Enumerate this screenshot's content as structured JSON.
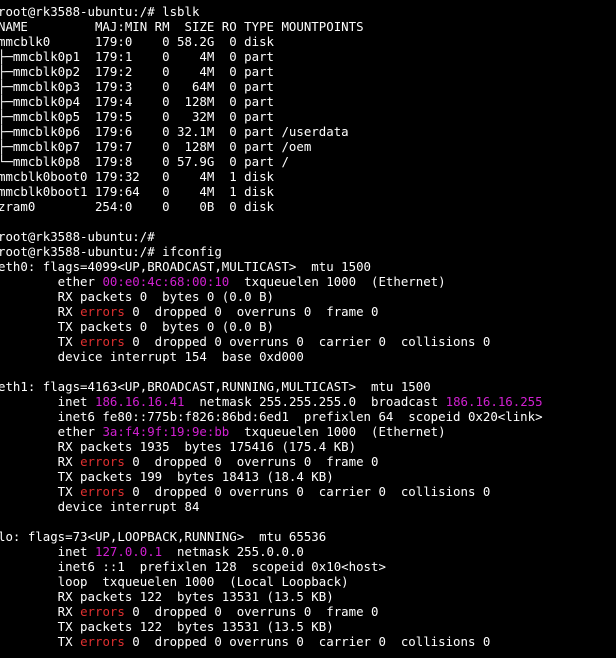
{
  "terminal": {
    "title": "",
    "colors": {
      "background": "#000000",
      "foreground": "#ffffff",
      "highlight": "#d020d0",
      "error": "#e03030"
    },
    "lines": [
      [
        {
          "t": "root@rk3588-ubuntu:/# lsblk"
        }
      ],
      [
        {
          "t": "NAME         MAJ:MIN RM  SIZE RO TYPE MOUNTPOINTS"
        }
      ],
      [
        {
          "t": "mmcblk0      179:0    0 58.2G  0 disk"
        }
      ],
      [
        {
          "t": "├─mmcblk0p1  179:1    0    4M  0 part"
        }
      ],
      [
        {
          "t": "├─mmcblk0p2  179:2    0    4M  0 part"
        }
      ],
      [
        {
          "t": "├─mmcblk0p3  179:3    0   64M  0 part"
        }
      ],
      [
        {
          "t": "├─mmcblk0p4  179:4    0  128M  0 part"
        }
      ],
      [
        {
          "t": "├─mmcblk0p5  179:5    0   32M  0 part"
        }
      ],
      [
        {
          "t": "├─mmcblk0p6  179:6    0 32.1M  0 part /userdata"
        }
      ],
      [
        {
          "t": "├─mmcblk0p7  179:7    0  128M  0 part /oem"
        }
      ],
      [
        {
          "t": "└─mmcblk0p8  179:8    0 57.9G  0 part /"
        }
      ],
      [
        {
          "t": "mmcblk0boot0 179:32   0    4M  1 disk"
        }
      ],
      [
        {
          "t": "mmcblk0boot1 179:64   0    4M  1 disk"
        }
      ],
      [
        {
          "t": "zram0        254:0    0    0B  0 disk"
        }
      ],
      [
        {
          "t": ""
        }
      ],
      [
        {
          "t": "root@rk3588-ubuntu:/#"
        }
      ],
      [
        {
          "t": "root@rk3588-ubuntu:/# ifconfig"
        }
      ],
      [
        {
          "t": "eth0: flags=4099<UP,BROADCAST,MULTICAST>  mtu 1500"
        }
      ],
      [
        {
          "t": "        ether "
        },
        {
          "t": "00:e0:4c:68:00:10",
          "c": "hl"
        },
        {
          "t": "  txqueuelen 1000  (Ethernet)"
        }
      ],
      [
        {
          "t": "        RX packets 0  bytes 0 (0.0 B)"
        }
      ],
      [
        {
          "t": "        RX "
        },
        {
          "t": "errors",
          "c": "err"
        },
        {
          "t": " 0  dropped 0  overruns 0  frame 0"
        }
      ],
      [
        {
          "t": "        TX packets 0  bytes 0 (0.0 B)"
        }
      ],
      [
        {
          "t": "        TX "
        },
        {
          "t": "errors",
          "c": "err"
        },
        {
          "t": " 0  dropped 0 overruns 0  carrier 0  collisions 0"
        }
      ],
      [
        {
          "t": "        device interrupt 154  base 0xd000"
        }
      ],
      [
        {
          "t": ""
        }
      ],
      [
        {
          "t": "eth1: flags=4163<UP,BROADCAST,RUNNING,MULTICAST>  mtu 1500"
        }
      ],
      [
        {
          "t": "        inet "
        },
        {
          "t": "186.16.16.41",
          "c": "hl"
        },
        {
          "t": "  netmask 255.255.255.0  broadcast "
        },
        {
          "t": "186.16.16.255",
          "c": "hl"
        }
      ],
      [
        {
          "t": "        inet6 fe80::775b:f826:86bd:6ed1  prefixlen 64  scopeid 0x20<link>"
        }
      ],
      [
        {
          "t": "        ether "
        },
        {
          "t": "3a:f4:9f:19:9e:bb",
          "c": "hl"
        },
        {
          "t": "  txqueuelen 1000  (Ethernet)"
        }
      ],
      [
        {
          "t": "        RX packets 1935  bytes 175416 (175.4 KB)"
        }
      ],
      [
        {
          "t": "        RX "
        },
        {
          "t": "errors",
          "c": "err"
        },
        {
          "t": " 0  dropped 0  overruns 0  frame 0"
        }
      ],
      [
        {
          "t": "        TX packets 199  bytes 18413 (18.4 KB)"
        }
      ],
      [
        {
          "t": "        TX "
        },
        {
          "t": "errors",
          "c": "err"
        },
        {
          "t": " 0  dropped 0 overruns 0  carrier 0  collisions 0"
        }
      ],
      [
        {
          "t": "        device interrupt 84"
        }
      ],
      [
        {
          "t": ""
        }
      ],
      [
        {
          "t": "lo: flags=73<UP,LOOPBACK,RUNNING>  mtu 65536"
        }
      ],
      [
        {
          "t": "        inet "
        },
        {
          "t": "127.0.0.1",
          "c": "hl"
        },
        {
          "t": "  netmask 255.0.0.0"
        }
      ],
      [
        {
          "t": "        inet6 ::1  prefixlen 128  scopeid 0x10<host>"
        }
      ],
      [
        {
          "t": "        loop  txqueuelen 1000  (Local Loopback)"
        }
      ],
      [
        {
          "t": "        RX packets 122  bytes 13531 (13.5 KB)"
        }
      ],
      [
        {
          "t": "        RX "
        },
        {
          "t": "errors",
          "c": "err"
        },
        {
          "t": " 0  dropped 0  overruns 0  frame 0"
        }
      ],
      [
        {
          "t": "        TX packets 122  bytes 13531 (13.5 KB)"
        }
      ],
      [
        {
          "t": "        TX "
        },
        {
          "t": "errors",
          "c": "err"
        },
        {
          "t": " 0  dropped 0 overruns 0  carrier 0  collisions 0"
        }
      ]
    ]
  }
}
